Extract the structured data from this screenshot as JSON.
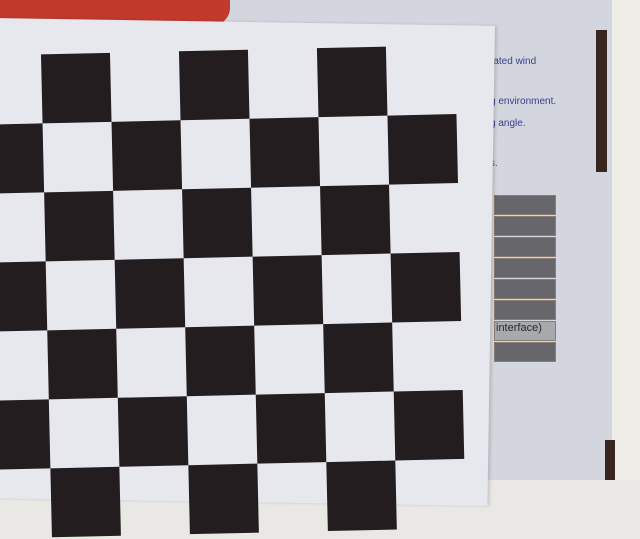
{
  "poster": {
    "lines": [
      "rated wind",
      "g environment.",
      "g angle.",
      "s."
    ],
    "bar_label": "interface)"
  },
  "checkerboard": {
    "rows": 7,
    "cols": 7
  },
  "colors": {
    "black_square": "#231d1f",
    "paper": "#e6e8ee",
    "poster": "#d3d6de",
    "red": "#c13a2c"
  }
}
